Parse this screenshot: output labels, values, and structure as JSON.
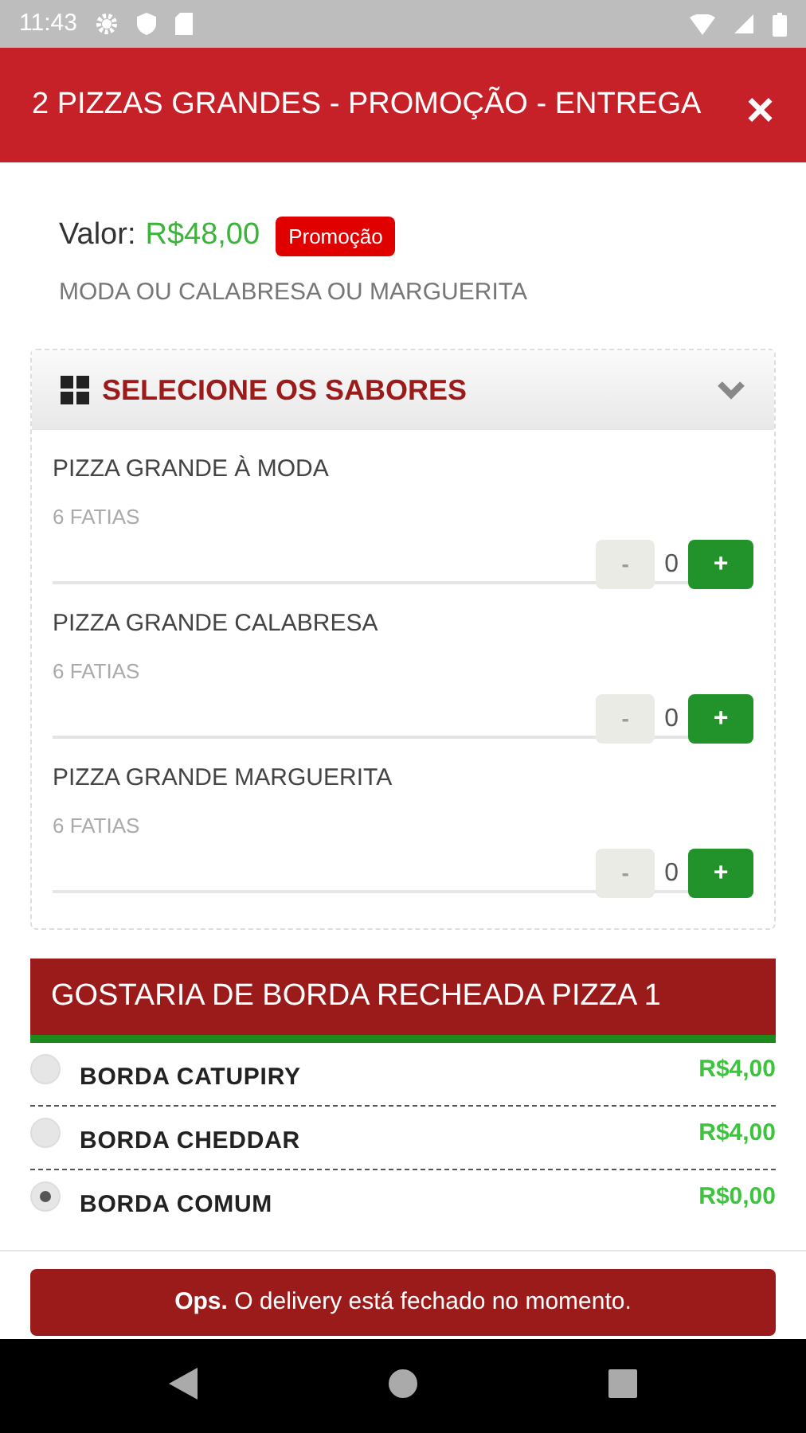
{
  "status_bar": {
    "time": "11:43"
  },
  "header": {
    "title": "2 PIZZAS GRANDES - PROMOÇÃO - ENTREGA",
    "close": "×"
  },
  "price": {
    "label": "Valor:",
    "value": "R$48,00",
    "badge": "Promoção",
    "description": "MODA OU CALABRESA OU MARGUERITA"
  },
  "flavors": {
    "title": "SELECIONE OS SABORES",
    "expanded": true,
    "items": [
      {
        "name": "PIZZA GRANDE À MODA",
        "detail": "6 FATIAS",
        "minus": "-",
        "count": "0",
        "plus": "+",
        "minus_disabled": true
      },
      {
        "name": "PIZZA GRANDE CALABRESA",
        "detail": "6 FATIAS",
        "minus": "-",
        "count": "0",
        "plus": "+",
        "minus_disabled": true
      },
      {
        "name": "PIZZA GRANDE MARGUERITA",
        "detail": "6 FATIAS",
        "minus": "-",
        "count": "0",
        "plus": "+",
        "minus_disabled": true
      }
    ]
  },
  "crust": {
    "title": "GOSTARIA DE BORDA RECHEADA PIZZA 1",
    "options": [
      {
        "name": "BORDA CATUPIRY",
        "price": "R$4,00",
        "selected": false
      },
      {
        "name": "BORDA CHEDDAR",
        "price": "R$4,00",
        "selected": false
      },
      {
        "name": "BORDA COMUM",
        "price": "R$0,00",
        "selected": true
      }
    ]
  },
  "alert": {
    "text": "**Ops.** O delivery está fechado no momento."
  }
}
